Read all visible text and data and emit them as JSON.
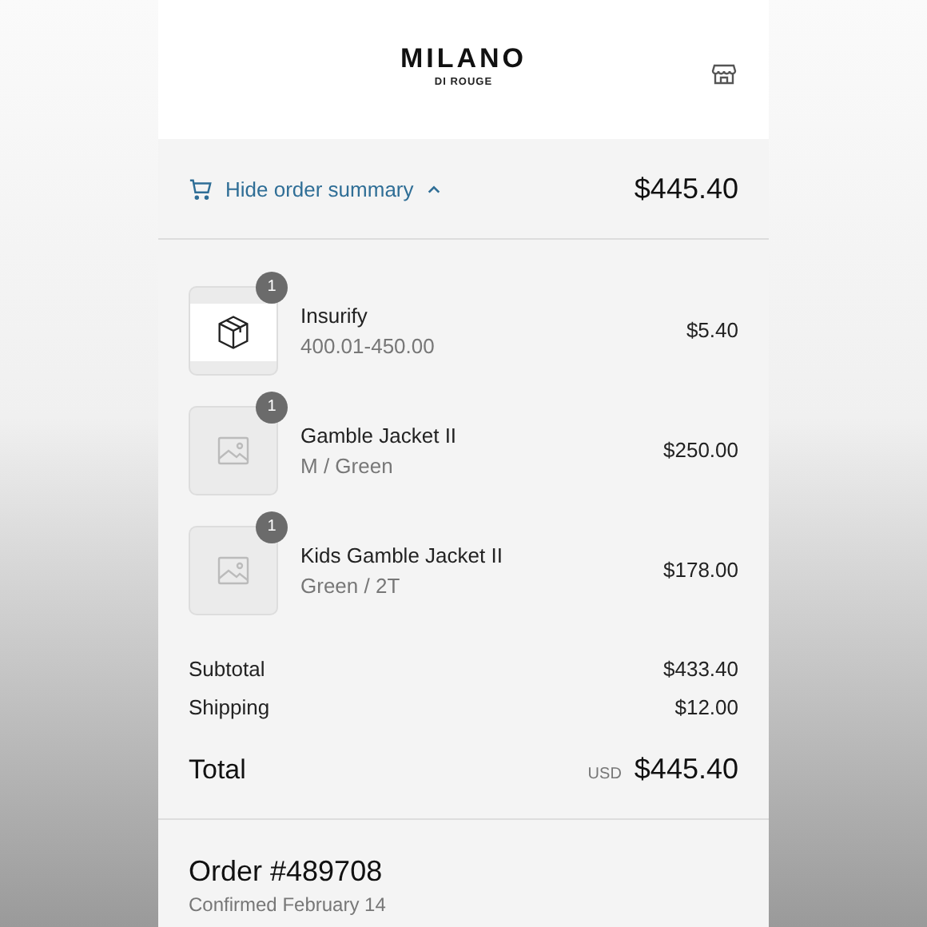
{
  "header": {
    "logo": "MILANO",
    "logo_sub": "DI ROUGE"
  },
  "summary_toggle": {
    "label": "Hide order summary",
    "expanded": true,
    "total": "$445.40"
  },
  "items": [
    {
      "kind": "box",
      "quantity": "1",
      "name": "Insurify",
      "variant": "400.01-450.00",
      "price": "$5.40"
    },
    {
      "kind": "placeholder",
      "quantity": "1",
      "name": "Gamble Jacket II",
      "variant": "M / Green",
      "price": "$250.00"
    },
    {
      "kind": "placeholder",
      "quantity": "1",
      "name": "Kids Gamble Jacket II",
      "variant": "Green / 2T",
      "price": "$178.00"
    }
  ],
  "lines": [
    {
      "label": "Subtotal",
      "value": "$433.40"
    },
    {
      "label": "Shipping",
      "value": "$12.00"
    }
  ],
  "total": {
    "label": "Total",
    "currency": "USD",
    "value": "$445.40"
  },
  "order": {
    "title": "Order #489708",
    "subtitle": "Confirmed February 14"
  }
}
